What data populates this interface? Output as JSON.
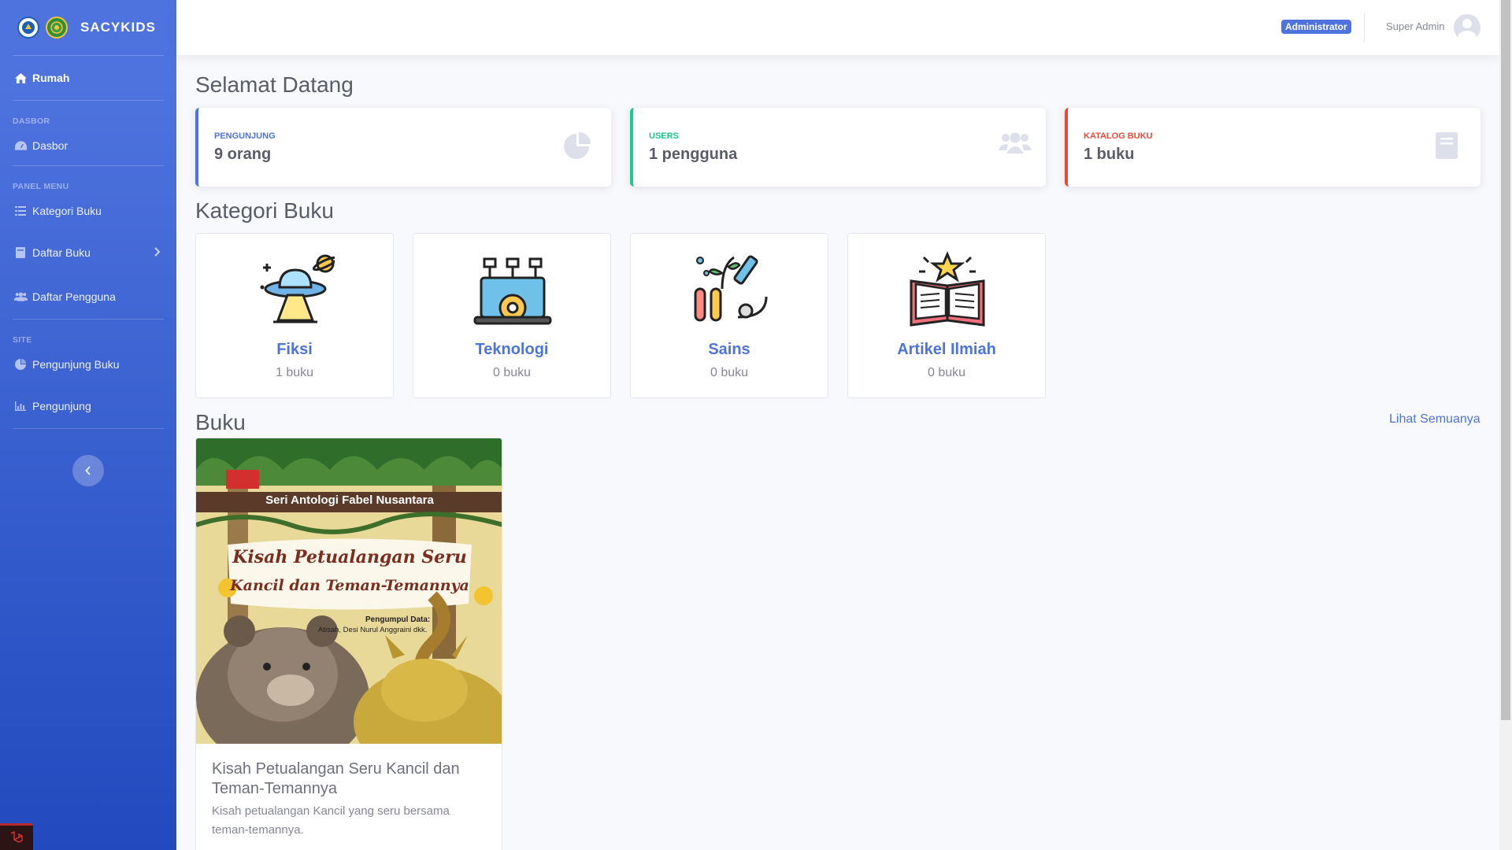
{
  "brand": {
    "name": "SACYKIDS"
  },
  "sidebar": {
    "items": [
      {
        "label": "Rumah",
        "icon": "home-icon"
      },
      {
        "label": "Dasbor",
        "icon": "tachometer-icon"
      },
      {
        "label": "Kategori Buku",
        "icon": "list-icon"
      },
      {
        "label": "Daftar Buku",
        "icon": "book-icon"
      },
      {
        "label": "Daftar Pengguna",
        "icon": "users-icon"
      },
      {
        "label": "Pengunjung Buku",
        "icon": "pie-chart-icon"
      },
      {
        "label": "Pengunjung",
        "icon": "bar-chart-icon"
      }
    ],
    "headings": [
      "DASBOR",
      "PANEL MENU",
      "SITE"
    ]
  },
  "topbar": {
    "role_badge": "Administrator",
    "user_name": "Super Admin"
  },
  "main": {
    "welcome_title": "Selamat Datang",
    "stats": [
      {
        "label": "PENGUNJUNG",
        "value": "9 orang",
        "color": "#4e73df"
      },
      {
        "label": "USERS",
        "value": "1 pengguna",
        "color": "#1cc88a"
      },
      {
        "label": "KATALOG BUKU",
        "value": "1 buku",
        "color": "#e74a3b"
      }
    ],
    "categories_title": "Kategori Buku",
    "categories": [
      {
        "name": "Fiksi",
        "count": "1 buku"
      },
      {
        "name": "Teknologi",
        "count": "0 buku"
      },
      {
        "name": "Sains",
        "count": "0 buku"
      },
      {
        "name": "Artikel Ilmiah",
        "count": "0 buku"
      }
    ],
    "books_title": "Buku",
    "see_all": "Lihat Semuanya",
    "books": [
      {
        "title": "Kisah Petualangan Seru Kancil dan Teman-Temannya",
        "description": "Kisah petualangan Kancil yang seru bersama teman-temannya.",
        "cover": {
          "series": "Seri Antologi Fabel Nusantara",
          "title_line1": "Kisah Petualangan Seru",
          "title_line2": "Kancil dan Teman-Temannya",
          "collector_label": "Pengumpul Data:",
          "collectors": "Atisah, Desi Nurul Anggraini dkk."
        }
      }
    ]
  }
}
